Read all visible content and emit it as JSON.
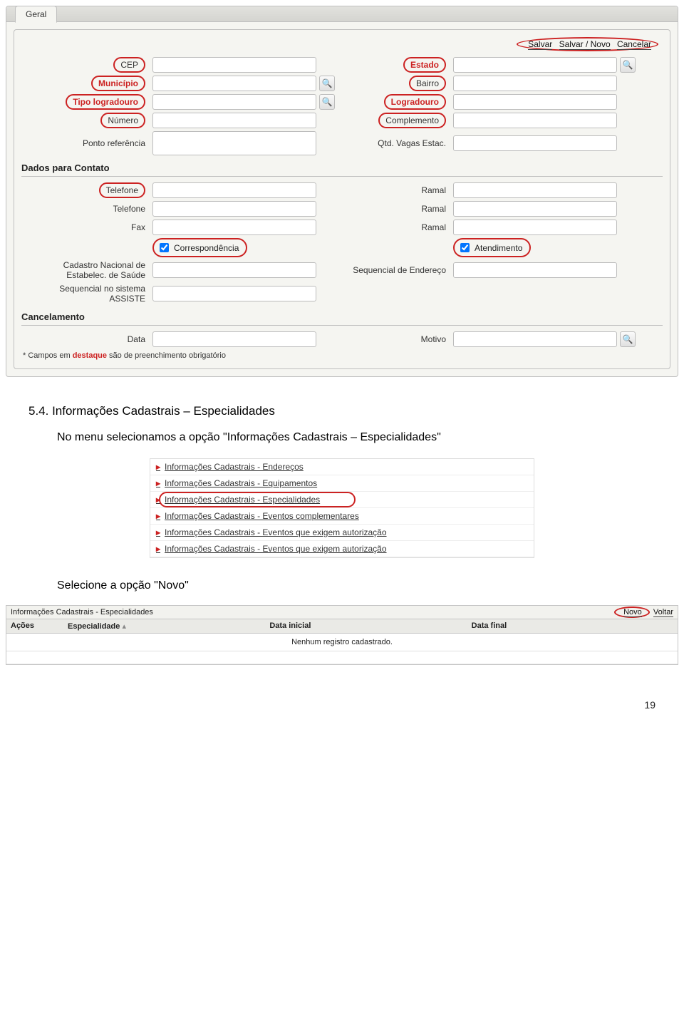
{
  "tab": {
    "geral": "Geral"
  },
  "actions": {
    "salvar": "Salvar",
    "salvar_novo": "Salvar / Novo",
    "cancelar": "Cancelar"
  },
  "address": {
    "cep": "CEP",
    "estado": "Estado",
    "municipio": "Município",
    "bairro": "Bairro",
    "tipo_log": "Tipo logradouro",
    "logradouro": "Logradouro",
    "numero": "Número",
    "complemento": "Complemento",
    "ponto_ref": "Ponto referência",
    "vagas": "Qtd. Vagas Estac."
  },
  "contact": {
    "section": "Dados para Contato",
    "telefone": "Telefone",
    "ramal": "Ramal",
    "fax": "Fax",
    "corresp": "Correspondência",
    "atend": "Atendimento",
    "cnes": "Cadastro Nacional de Estabelec. de Saúde",
    "seq_end": "Sequencial de Endereço",
    "seq_assiste": "Sequencial no sistema ASSISTE"
  },
  "cancel": {
    "section": "Cancelamento",
    "data": "Data",
    "motivo": "Motivo"
  },
  "footnote_a": "* Campos em ",
  "footnote_b": "destaque",
  "footnote_c": " são de preenchimento obrigatório",
  "section_num": "5.4. Informações Cadastrais – Especialidades",
  "body1": "No menu selecionamos a opção \"Informações Cadastrais – Especialidades\"",
  "menu": {
    "i1": "Informações Cadastrais - Endereços",
    "i2": "Informações Cadastrais - Equipamentos",
    "i3": "Informações Cadastrais - Especialidades",
    "i4": "Informações Cadastrais - Eventos complementares",
    "i5": "Informações Cadastrais - Eventos que exigem autorização",
    "i6": "Informações Cadastrais - Eventos que exigem autorização"
  },
  "body2": "Selecione a opção \"Novo\"",
  "list": {
    "title": "Informações Cadastrais - Especialidades",
    "novo": "Novo",
    "voltar": "Voltar",
    "c1": "Ações",
    "c2": "Especialidade",
    "c3": "Data inicial",
    "c4": "Data final",
    "empty": "Nenhum registro cadastrado."
  },
  "page": "19"
}
